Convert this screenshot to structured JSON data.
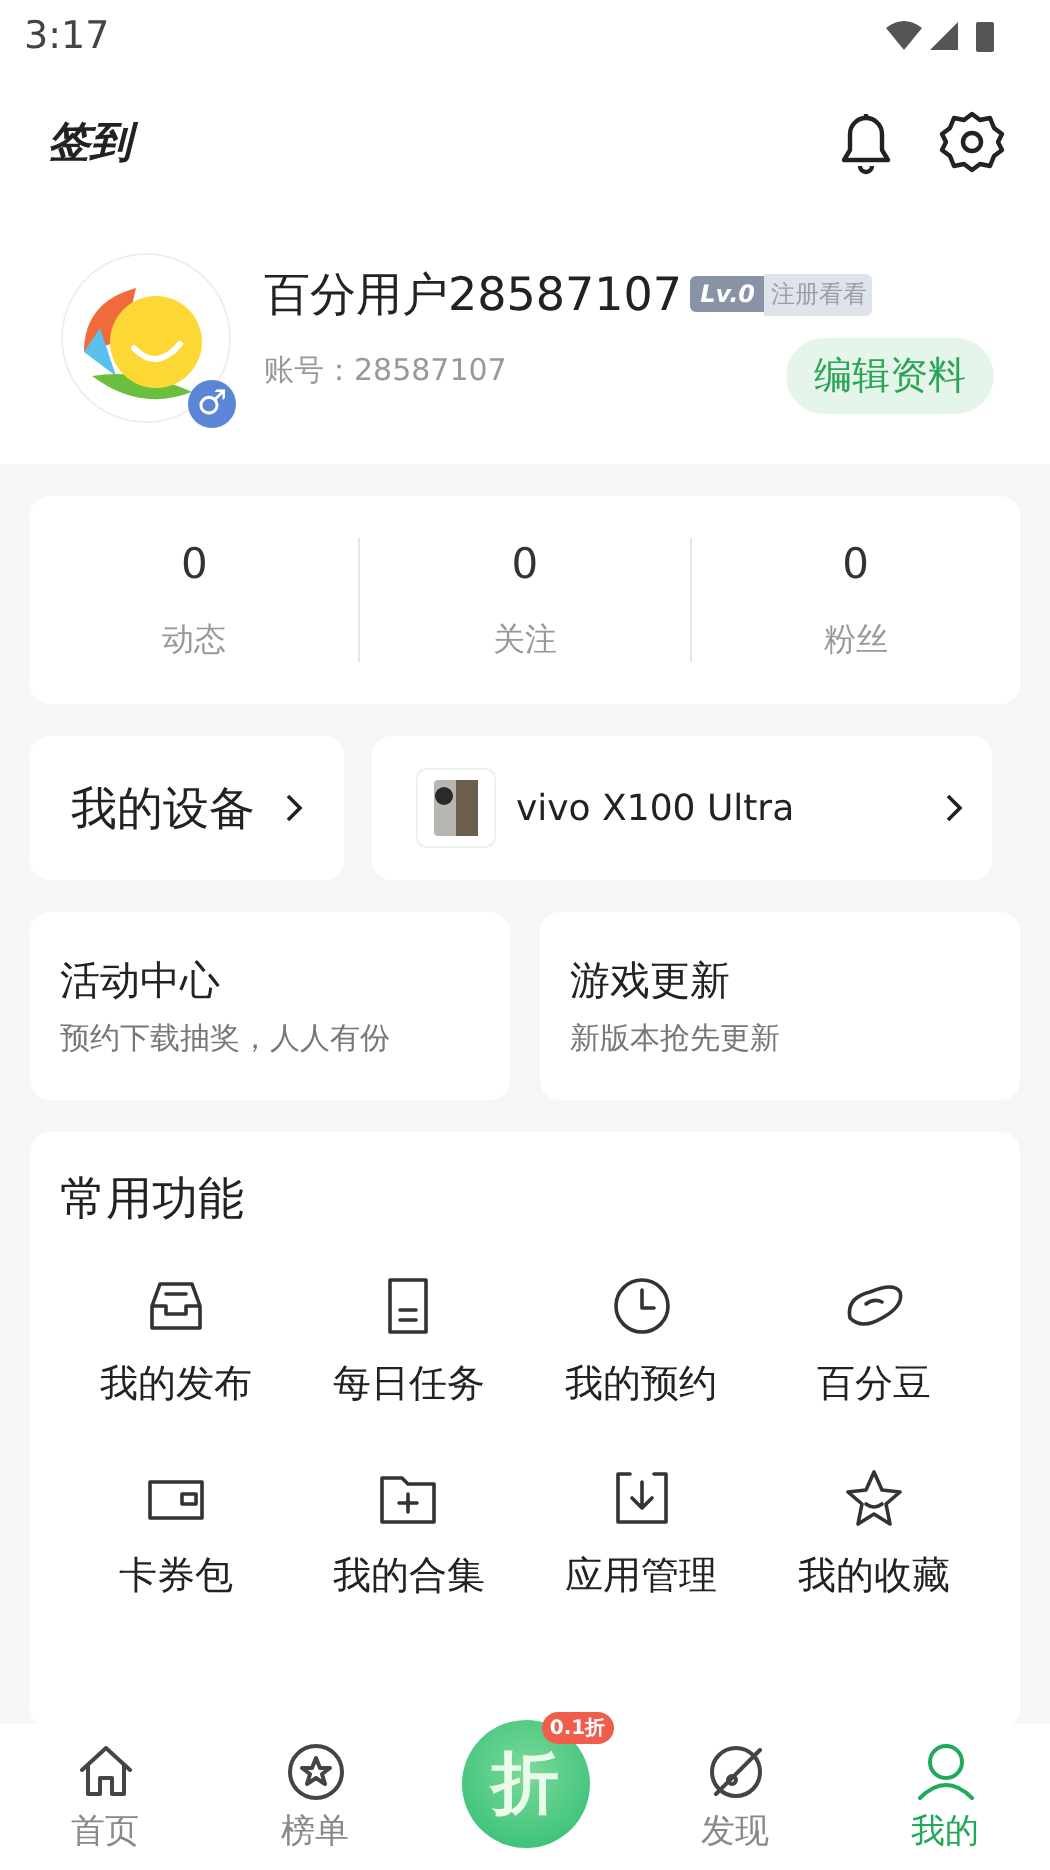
{
  "status_bar": {
    "time": "3:17"
  },
  "header": {
    "checkin": "签到"
  },
  "profile": {
    "name": "百分用户28587107",
    "level": "Lv.0",
    "register_hint": "注册看看",
    "account": "账号：28587107",
    "edit_button": "编辑资料",
    "gender_symbol": "♂"
  },
  "stats": [
    {
      "value": "0",
      "label": "动态"
    },
    {
      "value": "0",
      "label": "关注"
    },
    {
      "value": "0",
      "label": "粉丝"
    }
  ],
  "device": {
    "title": "我的设备",
    "model": "vivo X100 Ultra"
  },
  "promos": [
    {
      "title": "活动中心",
      "subtitle": "预约下载抽奖，人人有份"
    },
    {
      "title": "游戏更新",
      "subtitle": "新版本抢先更新"
    }
  ],
  "functions": {
    "title": "常用功能",
    "items": [
      {
        "label": "我的发布",
        "kind": "inbox"
      },
      {
        "label": "每日任务",
        "kind": "doc"
      },
      {
        "label": "我的预约",
        "kind": "clock"
      },
      {
        "label": "百分豆",
        "kind": "bean"
      },
      {
        "label": "卡券包",
        "kind": "wallet"
      },
      {
        "label": "我的合集",
        "kind": "folder"
      },
      {
        "label": "应用管理",
        "kind": "download"
      },
      {
        "label": "我的收藏",
        "kind": "star"
      }
    ]
  },
  "tab_bar": [
    {
      "label": "首页",
      "kind": "home",
      "selected": false
    },
    {
      "label": "榜单",
      "kind": "rank",
      "selected": false
    },
    {
      "kind": "center",
      "glyph": "折",
      "badge": "0.1折",
      "selected": false
    },
    {
      "label": "发现",
      "kind": "discover",
      "selected": false
    },
    {
      "label": "我的",
      "kind": "me",
      "selected": true
    }
  ]
}
